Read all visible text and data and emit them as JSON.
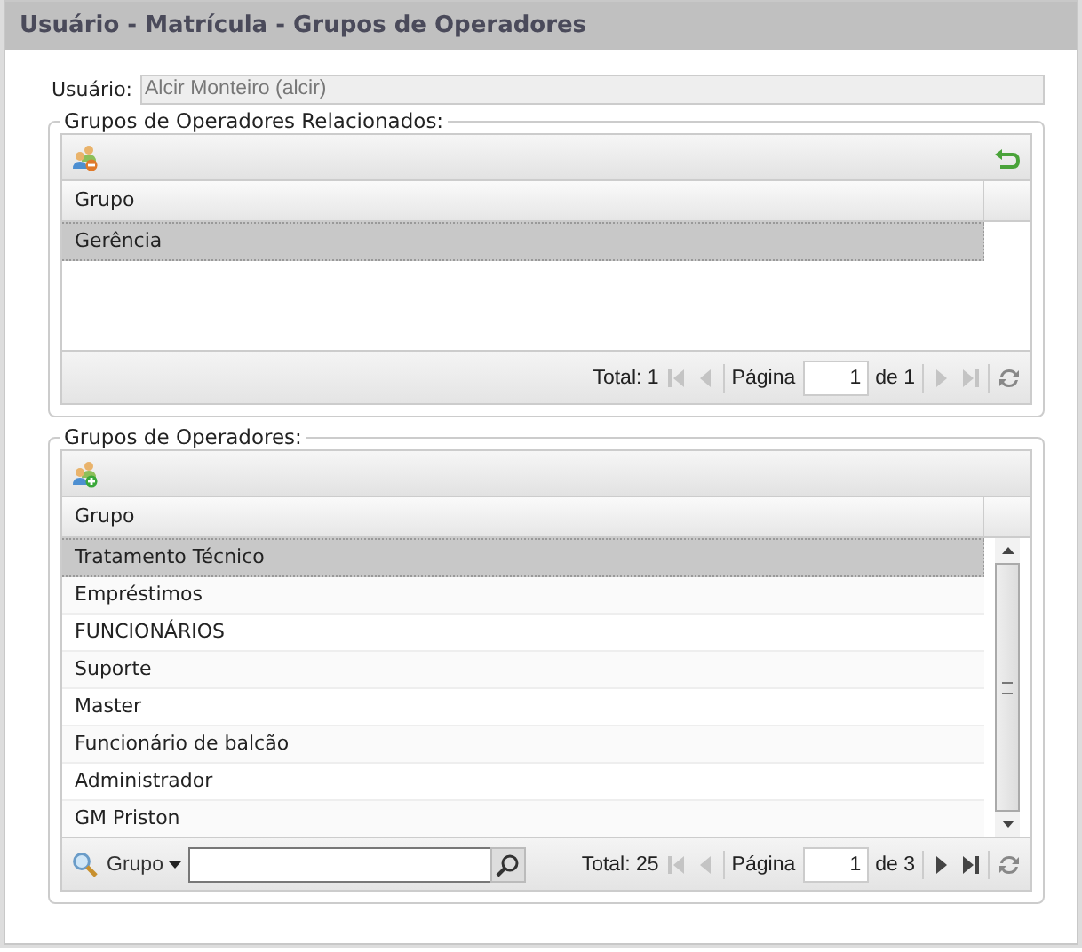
{
  "window": {
    "title": "Usuário - Matrícula - Grupos de Operadores"
  },
  "user_field": {
    "label": "Usuário:",
    "value": "Alcir Monteiro (alcir)"
  },
  "related_groups": {
    "legend": "Grupos de Operadores Relacionados:",
    "has_back": true,
    "columns": [
      "Grupo"
    ],
    "rows": [
      {
        "name": "Gerência",
        "selected": true
      }
    ],
    "pager": {
      "total": "Total: 1",
      "page_label": "Página",
      "page": "1",
      "of": "de 1",
      "prev_disabled": true,
      "next_disabled": true
    }
  },
  "groups": {
    "legend": "Grupos de Operadores:",
    "has_back": false,
    "columns": [
      "Grupo"
    ],
    "rows": [
      {
        "name": "Tratamento Técnico",
        "selected": true
      },
      {
        "name": "Empréstimos",
        "selected": false
      },
      {
        "name": "FUNCIONÁRIOS",
        "selected": false
      },
      {
        "name": "Suporte",
        "selected": false
      },
      {
        "name": "Master",
        "selected": false
      },
      {
        "name": "Funcionário de balcão",
        "selected": false
      },
      {
        "name": "Administrador",
        "selected": false
      },
      {
        "name": "GM Priston",
        "selected": false
      }
    ],
    "search": {
      "field": "Grupo"
    },
    "pager": {
      "total": "Total: 25",
      "page_label": "Página",
      "page": "1",
      "of": "de 3",
      "prev_disabled": true,
      "next_disabled": false
    }
  }
}
